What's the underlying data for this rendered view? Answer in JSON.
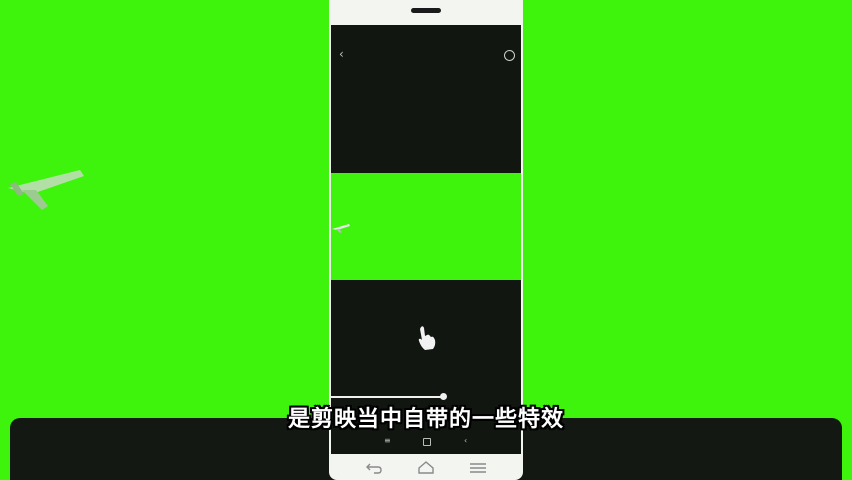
{
  "subtitle": {
    "text": "是剪映当中自带的一些特效"
  },
  "phone": {
    "top_bar": {
      "back_icon": "chevron-left-icon",
      "action_icon": "circle-icon"
    },
    "preview": {
      "background_color": "#3ef40c",
      "object_icon": "airplane-icon"
    },
    "gesture_icon": "hand-pointer-icon",
    "timeline": {
      "progress": 0.59
    },
    "screen_nav": {
      "menu_glyph": "≡",
      "back_glyph": "‹"
    },
    "hardware_buttons": [
      "back-arrow-icon",
      "home-icon",
      "menu-icon"
    ]
  },
  "colors": {
    "chroma_green": "#3ef40c",
    "screen_dark": "#111611",
    "band_dark": "#131813"
  }
}
